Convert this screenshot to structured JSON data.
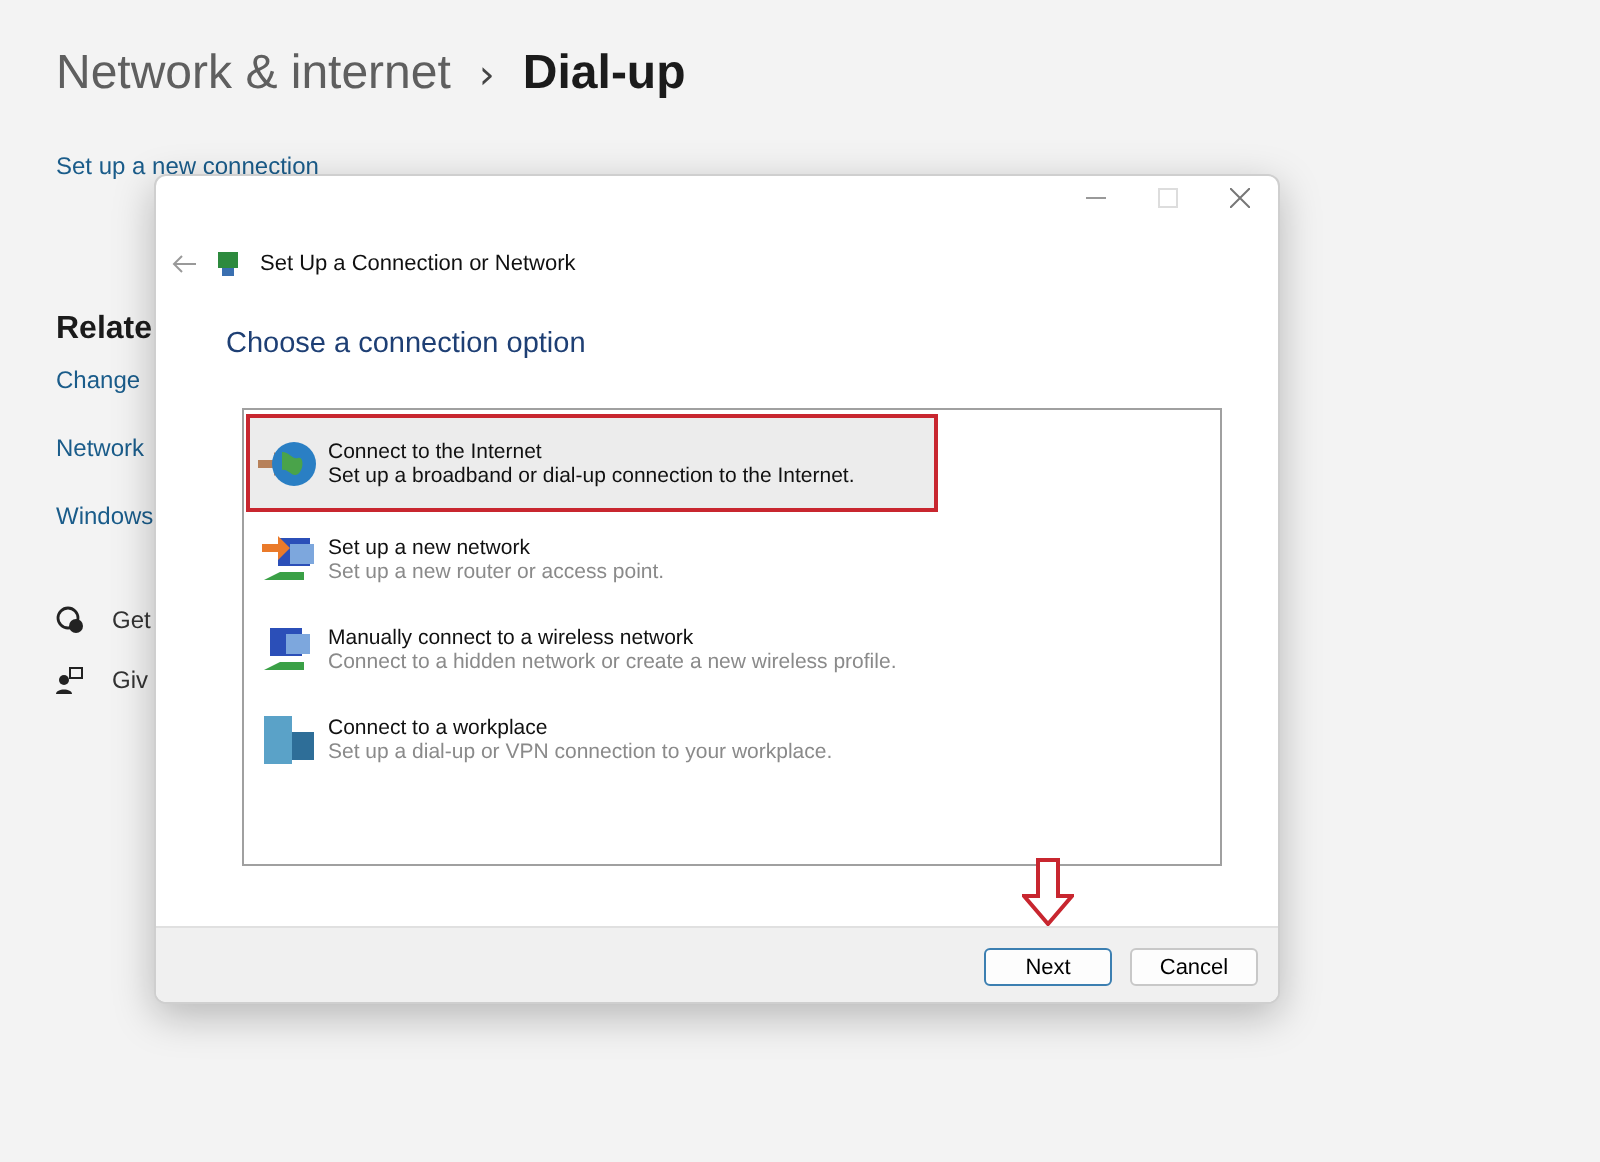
{
  "breadcrumb": {
    "parent": "Network & internet",
    "separator": "›",
    "current": "Dial-up"
  },
  "setup_link": "Set up a new connection",
  "related": {
    "heading": "Relate",
    "links": [
      "Change",
      "Network",
      "Windows"
    ]
  },
  "help_links": [
    {
      "kind": "help",
      "label": "Get"
    },
    {
      "kind": "feedback",
      "label": "Giv"
    }
  ],
  "dialog": {
    "title": "Set Up a Connection or Network",
    "heading": "Choose a connection option",
    "options": [
      {
        "kind": "globe",
        "title": "Connect to the Internet",
        "description": "Set up a broadband or dial-up connection to the Internet.",
        "selected": true,
        "outlined": true
      },
      {
        "kind": "router",
        "title": "Set up a new network",
        "description": "Set up a new router or access point.",
        "selected": false,
        "outlined": false
      },
      {
        "kind": "wireless",
        "title": "Manually connect to a wireless network",
        "description": "Connect to a hidden network or create a new wireless profile.",
        "selected": false,
        "outlined": false
      },
      {
        "kind": "workplace",
        "title": "Connect to a workplace",
        "description": "Set up a dial-up or VPN connection to your workplace.",
        "selected": false,
        "outlined": false
      }
    ],
    "buttons": [
      {
        "label": "Next",
        "default": true,
        "marked": true
      },
      {
        "label": "Cancel",
        "default": false,
        "marked": false
      }
    ]
  }
}
